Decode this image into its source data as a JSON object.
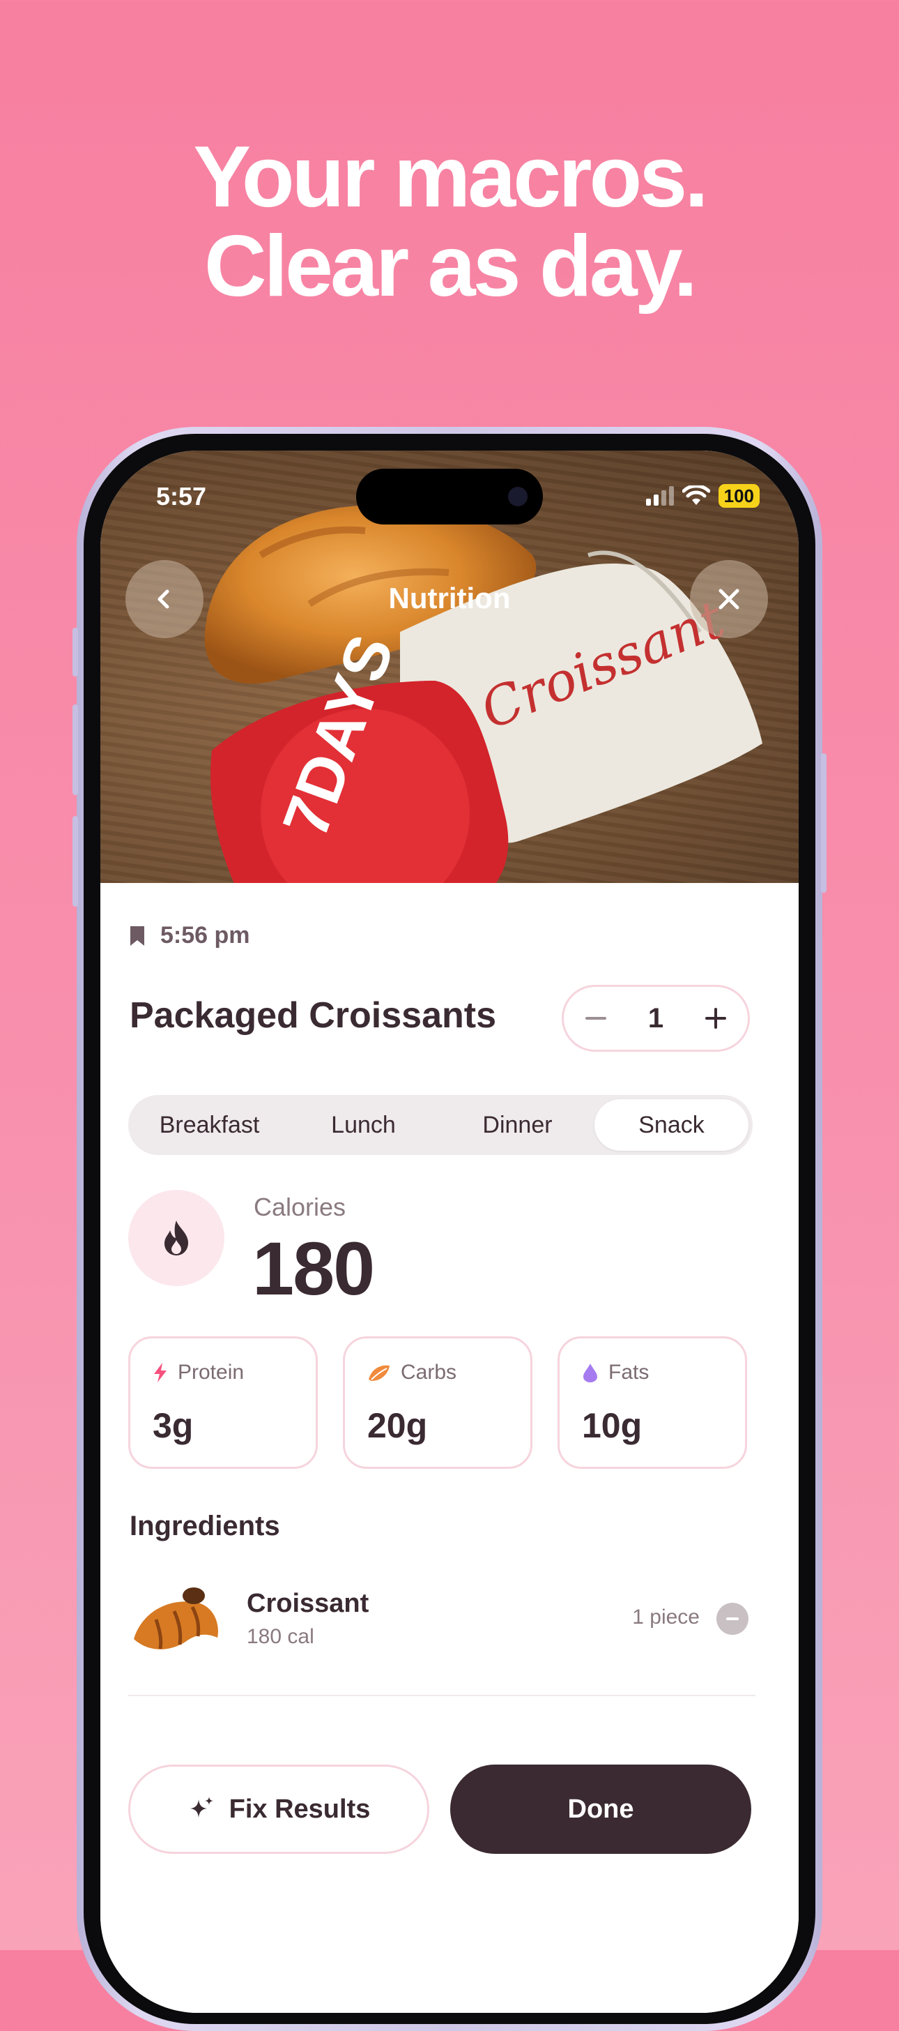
{
  "headline": {
    "line1": "Your macros.",
    "line2": "Clear as day."
  },
  "status": {
    "time": "5:57",
    "battery": "100"
  },
  "nav": {
    "title": "Nutrition"
  },
  "photo": {
    "pack_brand": "7DAYS",
    "pack_text": "Croissant"
  },
  "entry": {
    "time": "5:56 pm",
    "name": "Packaged Croissants",
    "quantity": "1"
  },
  "meal_tabs": [
    {
      "label": "Breakfast"
    },
    {
      "label": "Lunch"
    },
    {
      "label": "Dinner"
    },
    {
      "label": "Snack"
    }
  ],
  "meal_selected": "Snack",
  "calories": {
    "label": "Calories",
    "value": "180"
  },
  "macros": {
    "protein": {
      "label": "Protein",
      "value": "3g",
      "color": "#f5527e"
    },
    "carbs": {
      "label": "Carbs",
      "value": "20g",
      "color": "#f08a3c"
    },
    "fats": {
      "label": "Fats",
      "value": "10g",
      "color": "#a67bf0"
    }
  },
  "ingredients": {
    "title": "Ingredients",
    "items": [
      {
        "name": "Croissant",
        "calories": "180 cal",
        "quantity": "1 piece"
      }
    ]
  },
  "actions": {
    "fix_label": "Fix Results",
    "done_label": "Done"
  },
  "colors": {
    "background": "#f77fa0",
    "accent_border": "#f6d4dd",
    "primary_button": "#3b2a31"
  }
}
